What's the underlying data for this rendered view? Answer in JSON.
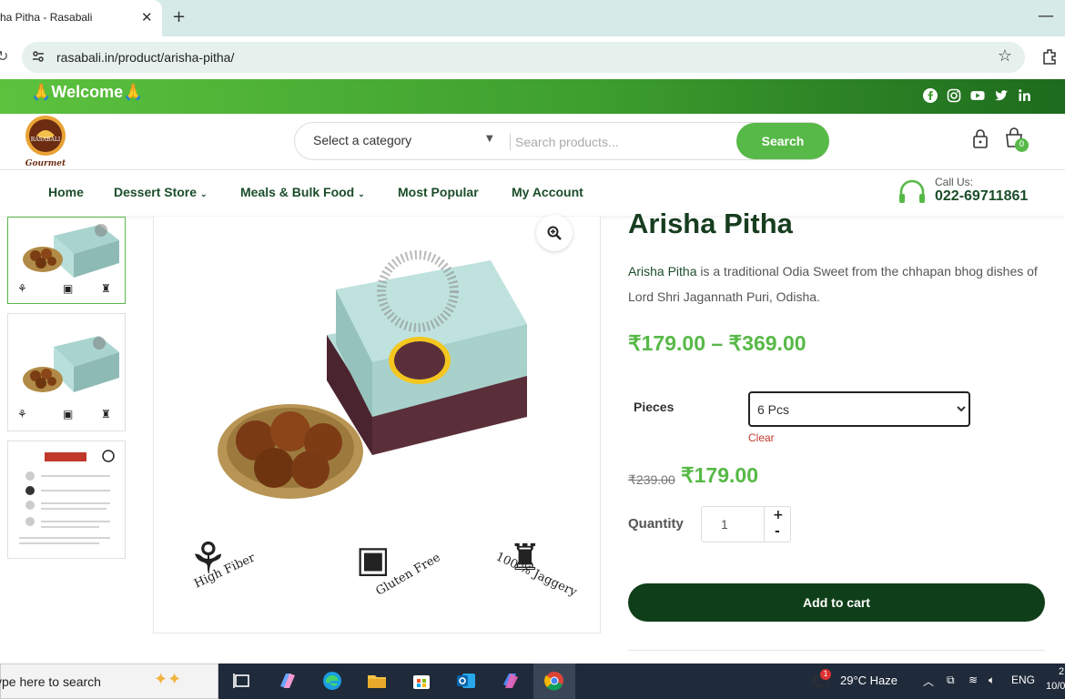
{
  "browser": {
    "tab_title": "ha Pitha - Rasabali",
    "tab_close": "✕",
    "new_tab": "+",
    "minimize": "—",
    "url": "rasabali.in/product/arisha-pitha/"
  },
  "topbar": {
    "welcome": "🙏Welcome🙏",
    "social": [
      "facebook-icon",
      "instagram-icon",
      "youtube-icon",
      "twitter-icon",
      "linkedin-icon"
    ]
  },
  "header": {
    "logo_text": "Gourmet",
    "logo_brand": "RASABALI",
    "category_placeholder": "Select a category",
    "search_placeholder": "Search products...",
    "search_button": "Search",
    "cart_count": "0"
  },
  "nav": {
    "items": [
      {
        "label": "Home"
      },
      {
        "label": "Dessert Store"
      },
      {
        "label": "Meals & Bulk Food"
      },
      {
        "label": "Most Popular"
      },
      {
        "label": "My Account"
      }
    ],
    "call_label": "Call Us:",
    "call_number": "022-69711861"
  },
  "product": {
    "title": "Arisha Pitha",
    "desc_highlight": "Arisha Pitha",
    "desc_rest": " is a traditional Odia Sweet from the chhapan bhog dishes of Lord Shri Jagannath Puri, Odisha.",
    "price_range": "₹179.00 – ₹369.00",
    "pieces_label": "Pieces",
    "pieces_selected": "6 Pcs",
    "clear": "Clear",
    "old_price": "₹239.00",
    "new_price": "₹179.00",
    "quantity_label": "Quantity",
    "quantity": "1",
    "plus": "+",
    "minus": "-",
    "add_to_cart": "Add to cart",
    "badges": [
      "High Fiber",
      "Gluten Free",
      "100 % Jaggery"
    ]
  },
  "taskbar": {
    "search_text": "ype here to search",
    "weather_badge": "1",
    "weather": "29°C  Haze",
    "language": "ENG",
    "time": "2",
    "date": "10/0"
  },
  "colors": {
    "brand_green": "#57b947",
    "dark_green": "#0f3f18",
    "title_green": "#173d1f"
  }
}
